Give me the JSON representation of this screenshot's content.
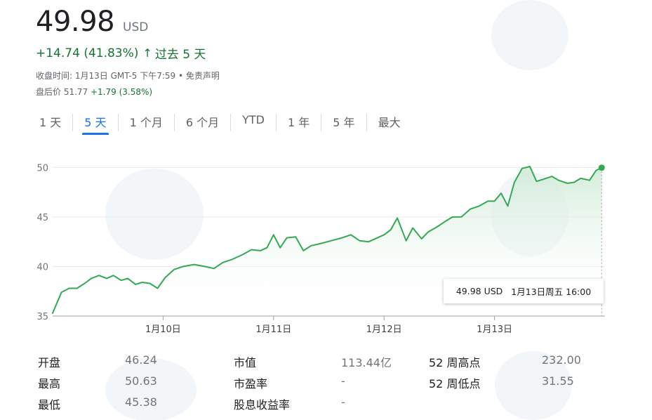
{
  "quote": {
    "price": "49.98",
    "currency": "USD",
    "change": "+14.74 (41.83%)",
    "change_arrow": "↑",
    "change_period": "过去 5 天",
    "close_time": "收盘时间: 1月13日 GMT-5 下午7:59",
    "separator": " • ",
    "disclaimer": "免责声明",
    "after_hours_label": "盘后价 51.77",
    "after_hours_change": "+1.79 (3.58%)"
  },
  "tabs": [
    "1 天",
    "5 天",
    "1 个月",
    "6 个月",
    "YTD",
    "1 年",
    "5 年",
    "最大"
  ],
  "active_tab": 1,
  "tooltip": {
    "value": "49.98 USD",
    "date": "1月13日周五 16:00"
  },
  "stats": {
    "col1": [
      {
        "label": "开盘",
        "value": "46.24"
      },
      {
        "label": "最高",
        "value": "50.63"
      },
      {
        "label": "最低",
        "value": "45.38"
      }
    ],
    "col2": [
      {
        "label": "市值",
        "value": "113.44亿"
      },
      {
        "label": "市盈率",
        "value": "-"
      },
      {
        "label": "股息收益率",
        "value": "-"
      }
    ],
    "col3": [
      {
        "label": "52 周高点",
        "value": "232.00"
      },
      {
        "label": "52 周低点",
        "value": "31.55"
      }
    ]
  },
  "colors": {
    "line": "#34a853",
    "fill_top": "#ceead6",
    "positive": "#137333",
    "accent": "#1a73e8"
  },
  "chart_data": {
    "type": "area",
    "y_ticks": [
      35,
      40,
      45,
      50
    ],
    "ylim": [
      35,
      50.1
    ],
    "x_ticks": [
      {
        "label": "1月10日",
        "x": 1
      },
      {
        "label": "1月11日",
        "x": 2
      },
      {
        "label": "1月12日",
        "x": 3
      },
      {
        "label": "1月13日",
        "x": 4
      }
    ],
    "xlim": [
      0,
      5
    ],
    "grid": true,
    "series": [
      {
        "x": [
          0,
          0.08,
          0.15,
          0.22,
          0.29,
          0.35,
          0.42,
          0.49,
          0.55,
          0.62,
          0.68,
          0.75,
          0.81,
          0.88,
          0.95,
          1.02,
          1.1,
          1.18,
          1.28,
          1.38,
          1.46,
          1.54,
          1.62,
          1.72,
          1.8,
          1.88,
          1.94,
          2.0,
          2.06,
          2.12,
          2.2,
          2.27,
          2.34,
          2.42,
          2.52,
          2.62,
          2.7,
          2.78,
          2.86,
          2.94,
          3.0,
          3.06,
          3.12,
          3.2,
          3.26,
          3.34,
          3.4,
          3.48,
          3.56,
          3.62,
          3.7,
          3.78,
          3.86,
          3.94,
          4.0,
          4.06,
          4.12,
          4.18,
          4.25,
          4.32,
          4.38,
          4.44,
          4.52,
          4.58,
          4.66,
          4.72,
          4.78,
          4.86,
          4.92,
          4.97
        ],
        "y": [
          35.3,
          37.4,
          37.8,
          37.8,
          38.3,
          38.8,
          39.1,
          38.8,
          39.1,
          38.6,
          38.8,
          38.2,
          38.4,
          38.3,
          37.8,
          38.9,
          39.7,
          40.0,
          40.2,
          40.0,
          39.8,
          40.4,
          40.7,
          41.2,
          41.7,
          41.6,
          41.9,
          43.2,
          41.9,
          42.9,
          43.0,
          41.6,
          42.1,
          42.3,
          42.6,
          42.9,
          43.2,
          42.6,
          42.5,
          42.9,
          43.2,
          43.7,
          44.9,
          42.6,
          43.9,
          42.8,
          43.5,
          44.0,
          44.6,
          45.0,
          45.0,
          45.8,
          46.1,
          46.6,
          46.6,
          47.4,
          46.1,
          48.5,
          49.9,
          50.1,
          48.6,
          48.8,
          49.1,
          48.7,
          48.4,
          48.5,
          48.9,
          48.7,
          49.7,
          49.98
        ]
      }
    ]
  }
}
